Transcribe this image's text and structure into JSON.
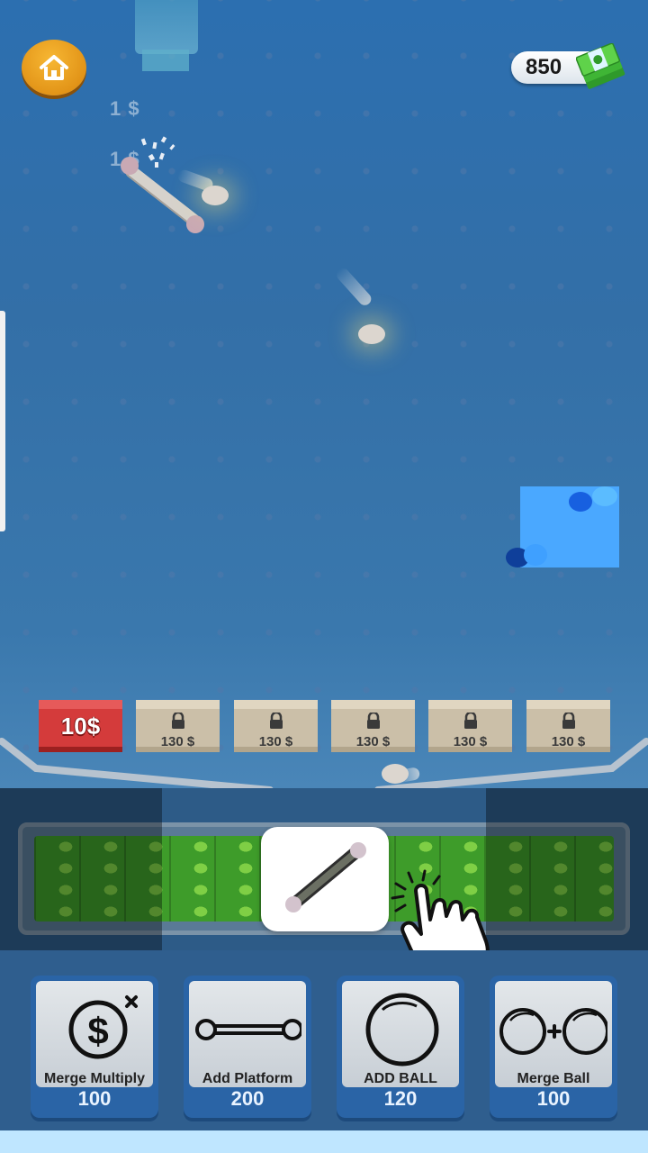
{
  "hud": {
    "money": "850",
    "home_icon": "home-icon",
    "cash_icon": "cash-stack-icon"
  },
  "floating_labels": [
    "1 $",
    "1 $"
  ],
  "crates": [
    {
      "price": "10$",
      "locked": false,
      "color": "#d43b3b"
    },
    {
      "price": "130 $",
      "locked": true
    },
    {
      "price": "130 $",
      "locked": true
    },
    {
      "price": "130 $",
      "locked": true
    },
    {
      "price": "130 $",
      "locked": true
    },
    {
      "price": "130 $",
      "locked": true
    }
  ],
  "shop": [
    {
      "label": "Merge Multiply",
      "price": "100",
      "icon": "dollar-multiply-icon"
    },
    {
      "label": "Add Platform",
      "price": "200",
      "icon": "platform-icon"
    },
    {
      "label": "ADD BALL",
      "price": "120",
      "icon": "ball-icon"
    },
    {
      "label": "Merge Ball",
      "price": "100",
      "icon": "merge-balls-icon"
    }
  ],
  "tutorial": {
    "icon": "platform-icon",
    "pointer": "tap-hand-icon"
  },
  "colors": {
    "sky": "#2c6fb0",
    "coin_button": "#f0a21e",
    "crate": "#cbbfa8",
    "crate_red": "#d43b3b",
    "cash_green": "#3e9c2a",
    "shop_button": "#2a64a6"
  }
}
